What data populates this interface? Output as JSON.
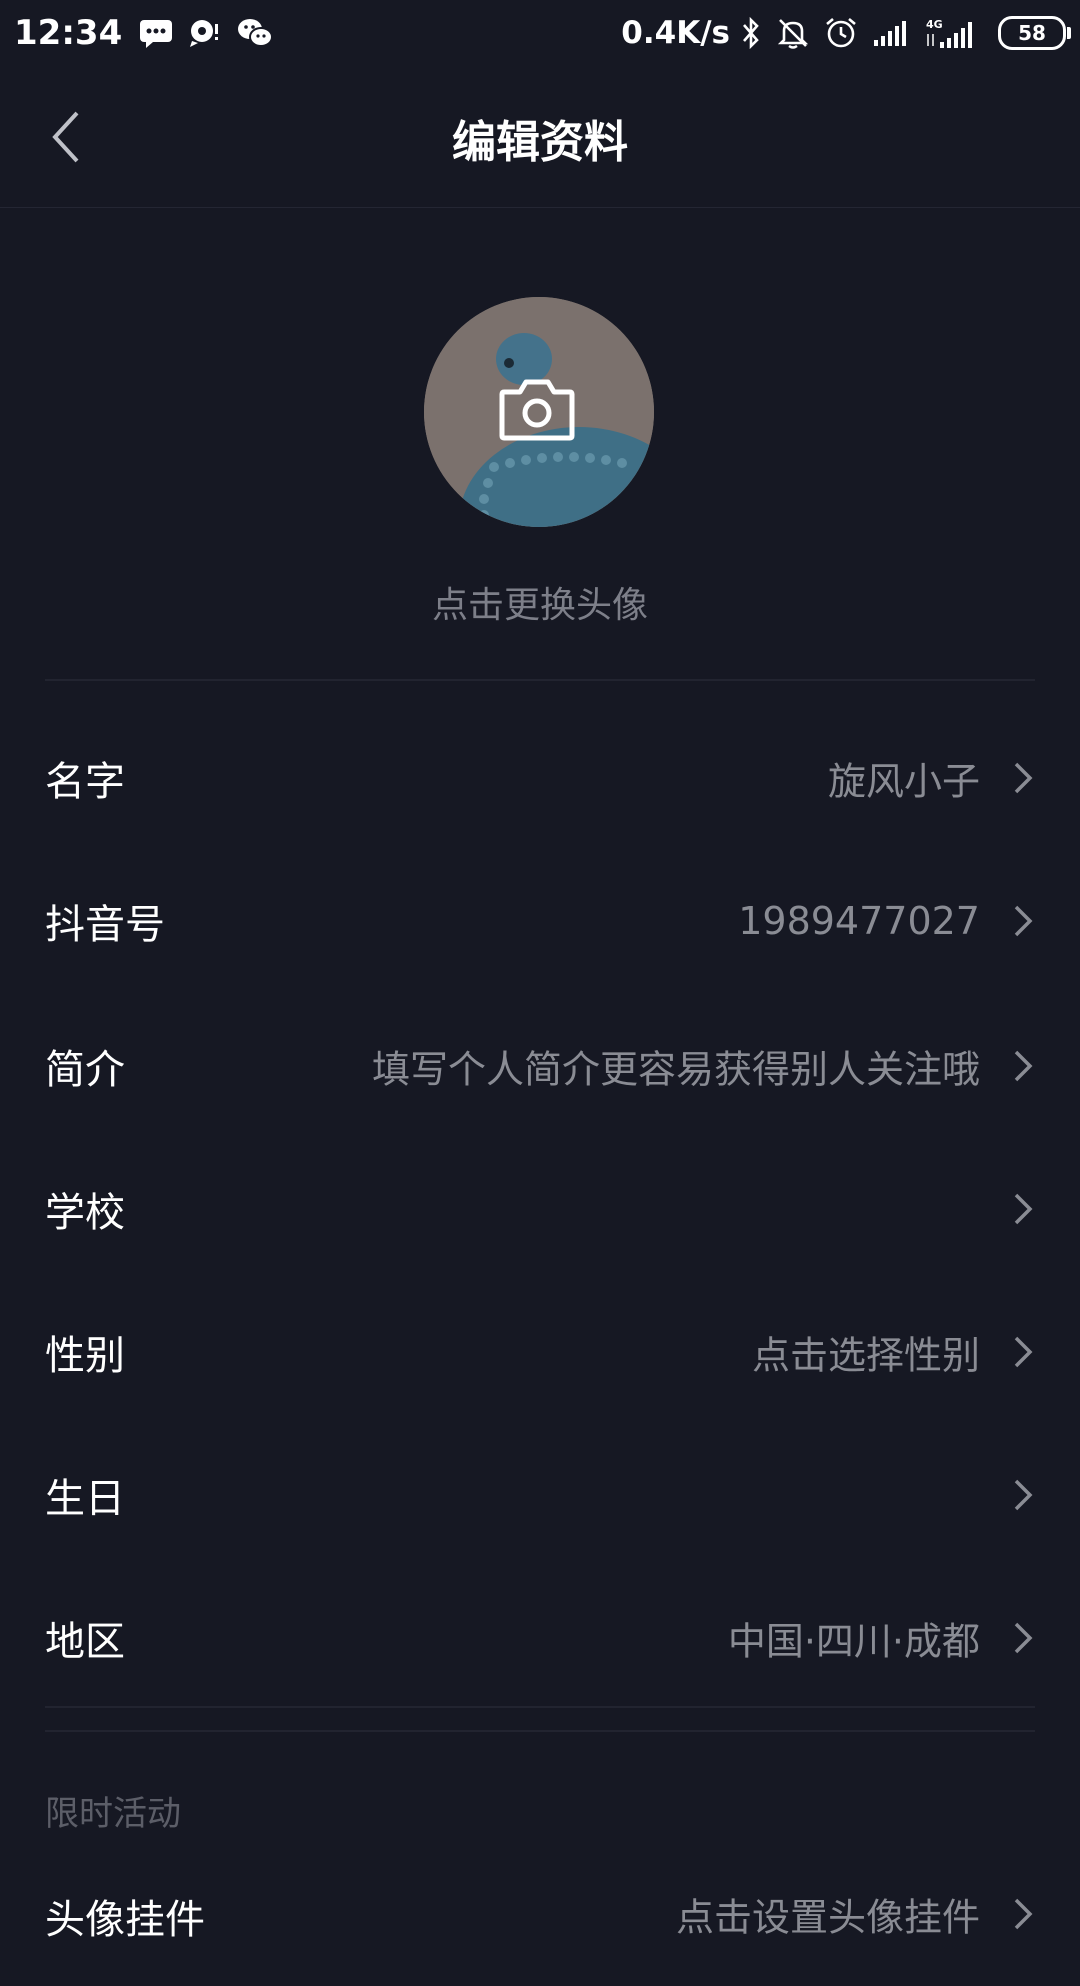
{
  "status_bar": {
    "time": "12:34",
    "network_speed": "0.4K/s",
    "battery": "58",
    "net_type": "4G",
    "icons": [
      "sms-icon",
      "chat-bubble-icon",
      "wechat-icon",
      "bluetooth-icon",
      "mute-icon",
      "alarm-icon",
      "signal-icon",
      "signal-4g-icon"
    ]
  },
  "header": {
    "title": "编辑资料",
    "back_icon": "chevron-left-icon"
  },
  "avatar": {
    "caption": "点击更换头像",
    "icon": "camera-icon"
  },
  "rows": [
    {
      "label": "名字",
      "value": "旋风小子"
    },
    {
      "label": "抖音号",
      "value": "1989477027"
    },
    {
      "label": "简介",
      "value": "填写个人简介更容易获得别人关注哦"
    },
    {
      "label": "学校",
      "value": ""
    },
    {
      "label": "性别",
      "value": "点击选择性别"
    },
    {
      "label": "生日",
      "value": ""
    },
    {
      "label": "地区",
      "value": "中国·四川·成都"
    }
  ],
  "section": {
    "title": "限时活动"
  },
  "pendant_row": {
    "label": "头像挂件",
    "value": "点击设置头像挂件"
  },
  "colors": {
    "background": "#161823",
    "secondary_text": "#8a8c94"
  }
}
